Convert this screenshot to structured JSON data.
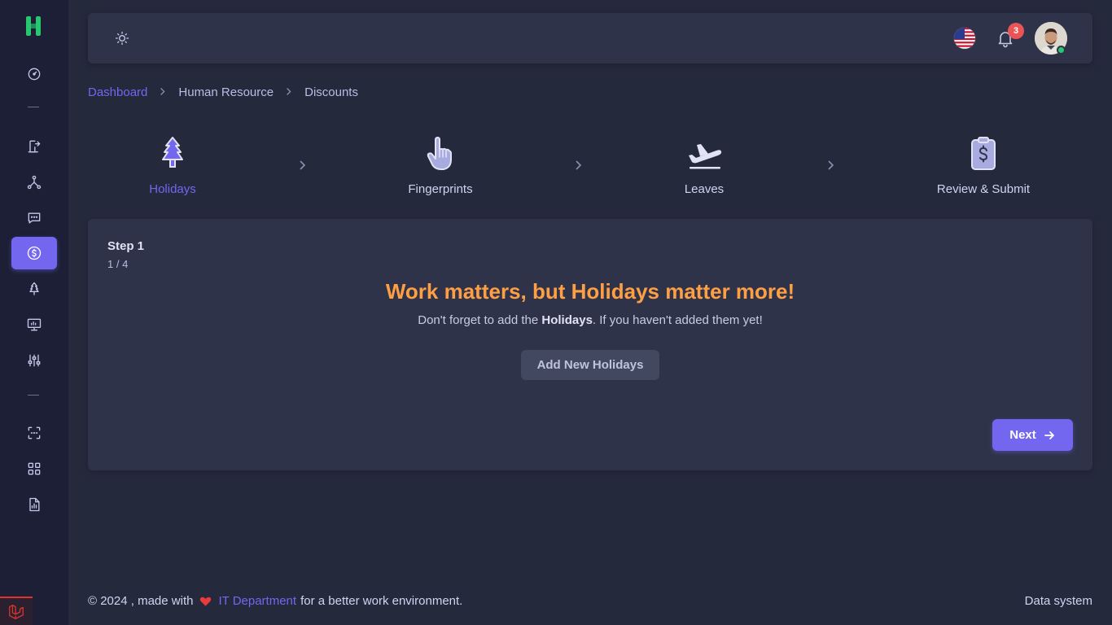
{
  "sidebar": {
    "items": [
      {
        "icon": "gauge-icon"
      },
      {
        "icon": "door-exit-icon"
      },
      {
        "icon": "network-icon"
      },
      {
        "icon": "message-icon"
      },
      {
        "icon": "dollar-icon",
        "active": true
      },
      {
        "icon": "tree-icon"
      },
      {
        "icon": "presentation-icon"
      },
      {
        "icon": "sliders-icon"
      },
      {
        "icon": "scan-icon"
      },
      {
        "icon": "apps-icon"
      },
      {
        "icon": "report-icon"
      }
    ]
  },
  "topbar": {
    "notifications_count": "3",
    "language": "en-US"
  },
  "breadcrumb": {
    "items": [
      "Dashboard",
      "Human Resource",
      "Discounts"
    ]
  },
  "stepper": {
    "steps": [
      {
        "label": "Holidays",
        "icon": "tree-icon",
        "active": true
      },
      {
        "label": "Fingerprints",
        "icon": "hand-pointer-icon",
        "active": false
      },
      {
        "label": "Leaves",
        "icon": "plane-departure-icon",
        "active": false
      },
      {
        "label": "Review & Submit",
        "icon": "clipboard-dollar-icon",
        "active": false
      }
    ]
  },
  "card": {
    "step_title": "Step 1",
    "step_count": "1 / 4",
    "headline": "Work matters, but Holidays matter more!",
    "subline_prefix": "Don't forget to add the ",
    "subline_bold": "Holidays",
    "subline_suffix": ". If you haven't added them yet!",
    "add_button": "Add New Holidays",
    "next_button": "Next"
  },
  "footer": {
    "copyright": "© 2024 , made with",
    "department": "IT Department",
    "tagline": "for a better work environment.",
    "right": "Data system"
  },
  "colors": {
    "accent": "#7367f0",
    "warning": "#ff9f43",
    "danger": "#ea5455",
    "success": "#28c76f",
    "background": "#25293c",
    "card": "#2f3349",
    "sidebar": "#1c1f36"
  }
}
